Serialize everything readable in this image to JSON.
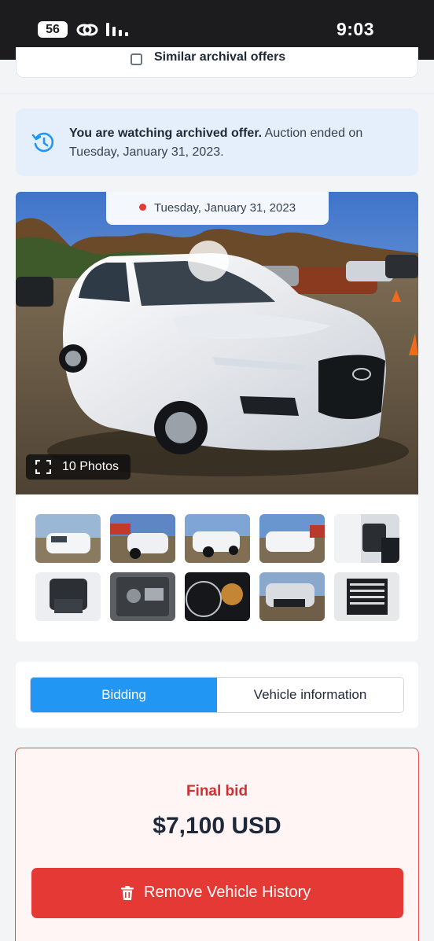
{
  "status_bar": {
    "signal": "56",
    "time": "9:03"
  },
  "similar_offers": {
    "label": "Similar archival offers"
  },
  "archive_notice": {
    "bold": "You are watching archived offer.",
    "rest": "Auction ended on Tuesday, January 31, 2023."
  },
  "gallery": {
    "date": "Tuesday, January 31, 2023",
    "photos_label": "10 Photos",
    "thumbnail_count": 10
  },
  "tabs": [
    {
      "label": "Bidding",
      "active": true
    },
    {
      "label": "Vehicle information",
      "active": false
    }
  ],
  "bid": {
    "title": "Final bid",
    "amount": "$7,100 USD",
    "remove_label": "Remove Vehicle History"
  },
  "colors": {
    "accent_blue": "#2196f3",
    "danger_red": "#e53935",
    "notice_bg": "#e4effb"
  }
}
